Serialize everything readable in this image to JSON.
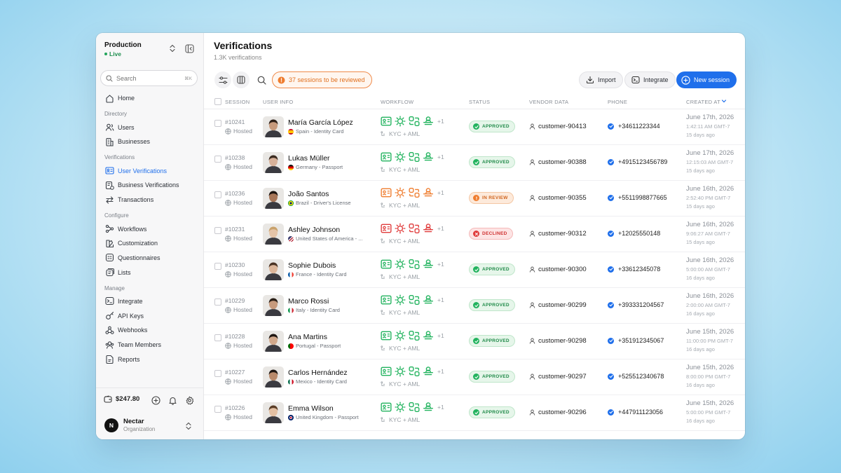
{
  "sidebar": {
    "env_name": "Production",
    "env_status": "Live",
    "search_placeholder": "Search",
    "search_shortcut": "⌘K",
    "nav": [
      {
        "type": "item",
        "label": "Home",
        "icon": "home-icon"
      },
      {
        "type": "section",
        "label": "Directory"
      },
      {
        "type": "item",
        "label": "Users",
        "icon": "users-icon"
      },
      {
        "type": "item",
        "label": "Businesses",
        "icon": "building-icon"
      },
      {
        "type": "section",
        "label": "Verifications"
      },
      {
        "type": "item",
        "label": "User Verifications",
        "icon": "id-card-icon",
        "active": true
      },
      {
        "type": "item",
        "label": "Business Verifications",
        "icon": "business-check-icon"
      },
      {
        "type": "item",
        "label": "Transactions",
        "icon": "transfer-icon"
      },
      {
        "type": "section",
        "label": "Configure"
      },
      {
        "type": "item",
        "label": "Workflows",
        "icon": "workflow-icon"
      },
      {
        "type": "item",
        "label": "Customization",
        "icon": "palette-icon"
      },
      {
        "type": "item",
        "label": "Questionnaires",
        "icon": "questionnaire-icon"
      },
      {
        "type": "item",
        "label": "Lists",
        "icon": "lists-icon"
      },
      {
        "type": "section",
        "label": "Manage"
      },
      {
        "type": "item",
        "label": "Integrate",
        "icon": "terminal-icon"
      },
      {
        "type": "item",
        "label": "API Keys",
        "icon": "key-icon"
      },
      {
        "type": "item",
        "label": "Webhooks",
        "icon": "webhook-icon"
      },
      {
        "type": "item",
        "label": "Team Members",
        "icon": "team-icon"
      },
      {
        "type": "item",
        "label": "Reports",
        "icon": "report-icon"
      }
    ],
    "balance": "$247.80",
    "org_initial": "N",
    "org_name": "Nectar",
    "org_type": "Organization"
  },
  "header": {
    "title": "Verifications",
    "count": "1.3K verifications",
    "review_pill": "37 sessions to be reviewed",
    "import_label": "Import",
    "integrate_label": "Integrate",
    "new_session_label": "New session"
  },
  "columns": [
    "SESSION",
    "USER INFO",
    "WORKFLOW",
    "STATUS",
    "VENDOR DATA",
    "PHONE",
    "CREATED AT"
  ],
  "colors": {
    "accent": "#1f6feb",
    "approved": "#22b35e",
    "review": "#ef7d2f",
    "declined": "#e03b3b"
  },
  "rows": [
    {
      "id": "#10241",
      "host": "Hosted",
      "name": "María García López",
      "doc": "Spain - Identity Card",
      "flag": "spain",
      "status": "approved",
      "status_label": "APPROVED",
      "workflow": "KYC + AML",
      "extra": "+1",
      "vendor": "customer-90413",
      "phone": "+34611223344",
      "date": "June 17th, 2026",
      "time": "1:42:11 AM GMT-7",
      "ago": "15 days ago",
      "skin": "#c79a7c",
      "hair": "#2d1f17"
    },
    {
      "id": "#10238",
      "host": "Hosted",
      "name": "Lukas Müller",
      "doc": "Germany - Passport",
      "flag": "germany",
      "status": "approved",
      "status_label": "APPROVED",
      "workflow": "KYC + AML",
      "extra": "+1",
      "vendor": "customer-90388",
      "phone": "+4915123456789",
      "date": "June 17th, 2026",
      "time": "12:15:03 AM GMT-7",
      "ago": "15 days ago",
      "skin": "#d7b199",
      "hair": "#3b2b20"
    },
    {
      "id": "#10236",
      "host": "Hosted",
      "name": "João Santos",
      "doc": "Brazil - Driver's License",
      "flag": "brazil",
      "status": "review",
      "status_label": "IN REVIEW",
      "workflow": "KYC + AML",
      "extra": "+1",
      "vendor": "customer-90355",
      "phone": "+5511998877665",
      "date": "June 16th, 2026",
      "time": "2:52:40 PM GMT-7",
      "ago": "15 days ago",
      "skin": "#a77658",
      "hair": "#1c1410"
    },
    {
      "id": "#10231",
      "host": "Hosted",
      "name": "Ashley Johnson",
      "doc": "United States of America - ...",
      "flag": "usa",
      "status": "declined",
      "status_label": "DECLINED",
      "workflow": "KYC + AML",
      "extra": "+1",
      "vendor": "customer-90312",
      "phone": "+12025550148",
      "date": "June 16th, 2026",
      "time": "9:06:27 AM GMT-7",
      "ago": "15 days ago",
      "skin": "#e5c4a8",
      "hair": "#c9a26b"
    },
    {
      "id": "#10230",
      "host": "Hosted",
      "name": "Sophie Dubois",
      "doc": "France - Identity Card",
      "flag": "france",
      "status": "approved",
      "status_label": "APPROVED",
      "workflow": "KYC + AML",
      "extra": "+1",
      "vendor": "customer-90300",
      "phone": "+33612345078",
      "date": "June 16th, 2026",
      "time": "5:00:00 AM GMT-7",
      "ago": "16 days ago",
      "skin": "#dcb69a",
      "hair": "#4a3324"
    },
    {
      "id": "#10229",
      "host": "Hosted",
      "name": "Marco Rossi",
      "doc": "Italy - Identity Card",
      "flag": "italy",
      "status": "approved",
      "status_label": "APPROVED",
      "workflow": "KYC + AML",
      "extra": "+1",
      "vendor": "customer-90299",
      "phone": "+393331204567",
      "date": "June 16th, 2026",
      "time": "2:00:00 AM GMT-7",
      "ago": "16 days ago",
      "skin": "#c79a7c",
      "hair": "#2a1e16"
    },
    {
      "id": "#10228",
      "host": "Hosted",
      "name": "Ana Martins",
      "doc": "Portugal - Passport",
      "flag": "portugal",
      "status": "approved",
      "status_label": "APPROVED",
      "workflow": "KYC + AML",
      "extra": "+1",
      "vendor": "customer-90298",
      "phone": "+351912345067",
      "date": "June 15th, 2026",
      "time": "11:00:00 PM GMT-7",
      "ago": "16 days ago",
      "skin": "#d2a98c",
      "hair": "#1f1611"
    },
    {
      "id": "#10227",
      "host": "Hosted",
      "name": "Carlos Hernández",
      "doc": "Mexico - Identity Card",
      "flag": "mexico",
      "status": "approved",
      "status_label": "APPROVED",
      "workflow": "KYC + AML",
      "extra": "+1",
      "vendor": "customer-90297",
      "phone": "+525512340678",
      "date": "June 15th, 2026",
      "time": "8:00:00 PM GMT-7",
      "ago": "16 days ago",
      "skin": "#b98a6b",
      "hair": "#1e1612"
    },
    {
      "id": "#10226",
      "host": "Hosted",
      "name": "Emma Wilson",
      "doc": "United Kingdom - Passport",
      "flag": "uk",
      "status": "approved",
      "status_label": "APPROVED",
      "workflow": "KYC + AML",
      "extra": "+1",
      "vendor": "customer-90296",
      "phone": "+447911123056",
      "date": "June 15th, 2026",
      "time": "5:00:00 PM GMT-7",
      "ago": "16 days ago",
      "skin": "#e3c0a3",
      "hair": "#5a3d26"
    }
  ]
}
